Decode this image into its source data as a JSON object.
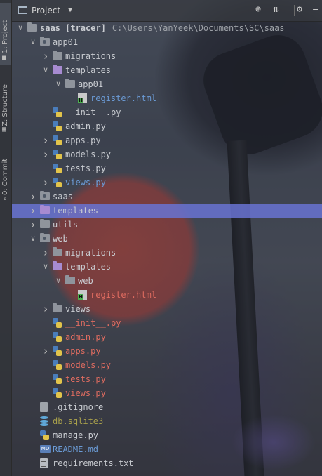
{
  "window": {
    "title": "Project"
  },
  "tool_strip": {
    "tabs": [
      {
        "label": "1: Project",
        "icon": "folder-icon"
      },
      {
        "label": "Z: Structure",
        "icon": "structure-icon"
      },
      {
        "label": "0: Commit",
        "icon": "commit-icon"
      }
    ]
  },
  "header": {
    "title": "Project",
    "icons": [
      "target-icon",
      "collapse-all-icon",
      "gear-icon",
      "minimize-icon"
    ]
  },
  "tree": [
    {
      "name": "saas [tracer]",
      "path": "C:\\Users\\YanYeek\\Documents\\SC\\saas",
      "type": "root-folder",
      "expanded": true,
      "color": "bold"
    },
    {
      "name": "app01",
      "type": "folder",
      "expanded": true
    },
    {
      "name": "migrations",
      "type": "folder",
      "expanded": false
    },
    {
      "name": "templates",
      "type": "folder-purple",
      "expanded": true
    },
    {
      "name": "app01",
      "type": "folder",
      "expanded": true
    },
    {
      "name": "register.html",
      "type": "html",
      "color": "blue"
    },
    {
      "name": "__init__.py",
      "type": "py"
    },
    {
      "name": "admin.py",
      "type": "py"
    },
    {
      "name": "apps.py",
      "type": "py",
      "expandable": true
    },
    {
      "name": "models.py",
      "type": "py",
      "expandable": true
    },
    {
      "name": "tests.py",
      "type": "py"
    },
    {
      "name": "views.py",
      "type": "py",
      "color": "blue",
      "expandable": true
    },
    {
      "name": "saas",
      "type": "folder",
      "expanded": false
    },
    {
      "name": "templates",
      "type": "folder-purple",
      "selected": true
    },
    {
      "name": "utils",
      "type": "folder",
      "expanded": false
    },
    {
      "name": "web",
      "type": "folder",
      "expanded": true
    },
    {
      "name": "migrations",
      "type": "folder",
      "expanded": false
    },
    {
      "name": "templates",
      "type": "folder-purple",
      "expanded": true
    },
    {
      "name": "web",
      "type": "folder",
      "expanded": true
    },
    {
      "name": "register.html",
      "type": "html",
      "color": "red"
    },
    {
      "name": "views",
      "type": "folder",
      "expanded": false
    },
    {
      "name": "__init__.py",
      "type": "py",
      "color": "red"
    },
    {
      "name": "admin.py",
      "type": "py",
      "color": "red"
    },
    {
      "name": "apps.py",
      "type": "py",
      "color": "red",
      "expandable": true
    },
    {
      "name": "models.py",
      "type": "py",
      "color": "red"
    },
    {
      "name": "tests.py",
      "type": "py",
      "color": "red"
    },
    {
      "name": "views.py",
      "type": "py",
      "color": "red"
    },
    {
      "name": ".gitignore",
      "type": "git"
    },
    {
      "name": "db.sqlite3",
      "type": "db",
      "color": "olive"
    },
    {
      "name": "manage.py",
      "type": "py"
    },
    {
      "name": "README.md",
      "type": "md",
      "color": "blue"
    },
    {
      "name": "requirements.txt",
      "type": "txt"
    }
  ],
  "colors": {
    "selection": "#6973d2",
    "purple_folder": "#a78bd1",
    "modified_blue": "#6b9bd6",
    "unversioned_red": "#e06c60"
  }
}
